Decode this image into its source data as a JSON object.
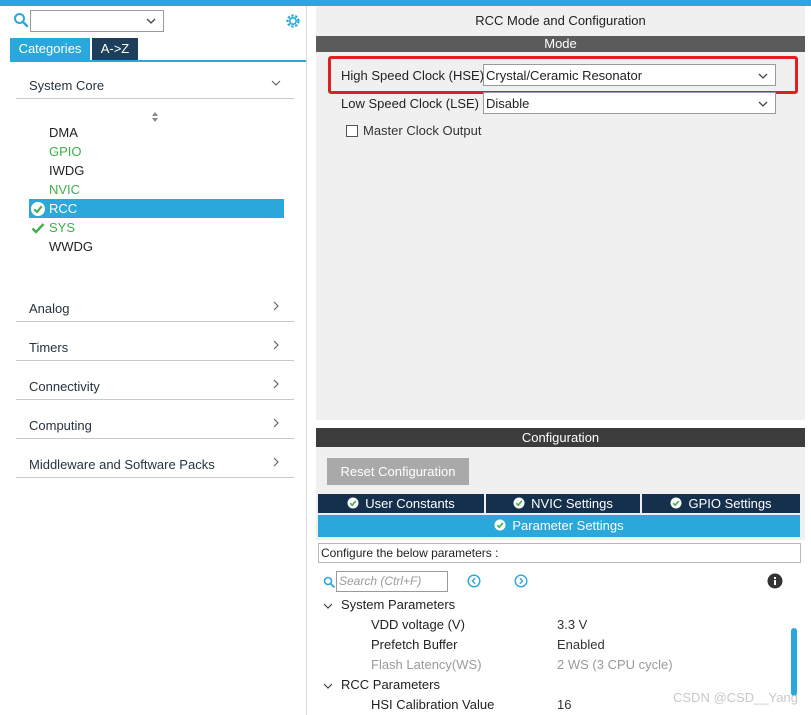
{
  "left": {
    "search": {
      "value": ""
    },
    "tabs": [
      {
        "label": "Categories",
        "active": true
      },
      {
        "label": "A->Z",
        "active": false
      }
    ],
    "system_core": {
      "label": "System Core",
      "items": [
        {
          "label": "DMA",
          "state": "normal"
        },
        {
          "label": "GPIO",
          "state": "configured"
        },
        {
          "label": "IWDG",
          "state": "normal"
        },
        {
          "label": "NVIC",
          "state": "configured"
        },
        {
          "label": "RCC",
          "state": "selected-checked"
        },
        {
          "label": "SYS",
          "state": "checked"
        },
        {
          "label": "WWDG",
          "state": "normal"
        }
      ]
    },
    "categories": [
      {
        "label": "Analog"
      },
      {
        "label": "Timers"
      },
      {
        "label": "Connectivity"
      },
      {
        "label": "Computing"
      },
      {
        "label": "Middleware and Software Packs"
      }
    ]
  },
  "right": {
    "title": "RCC Mode and Configuration",
    "mode_header": "Mode",
    "hse": {
      "label": "High Speed Clock (HSE)",
      "value": "Crystal/Ceramic Resonator"
    },
    "lse": {
      "label": "Low Speed Clock (LSE)",
      "value": "Disable"
    },
    "mco": {
      "label": "Master Clock Output",
      "checked": false
    },
    "config_header": "Configuration",
    "reset_button": "Reset Configuration",
    "settings_tabs": [
      {
        "label": "User Constants"
      },
      {
        "label": "NVIC Settings"
      },
      {
        "label": "GPIO Settings"
      }
    ],
    "parameter_tab": "Parameter Settings",
    "hint": "Configure the below parameters :",
    "search_placeholder": "Search (Ctrl+F)",
    "groups": [
      {
        "label": "System Parameters",
        "rows": [
          {
            "name": "VDD voltage (V)",
            "value": "3.3 V",
            "dim": false
          },
          {
            "name": "Prefetch Buffer",
            "value": "Enabled",
            "dim": false
          },
          {
            "name": "Flash Latency(WS)",
            "value": "2 WS (3 CPU cycle)",
            "dim": true
          }
        ]
      },
      {
        "label": "RCC Parameters",
        "rows": [
          {
            "name": "HSI Calibration Value",
            "value": "16",
            "dim": false
          }
        ]
      }
    ]
  },
  "watermark": "CSDN @CSD__Yang",
  "colors": {
    "accent": "#2aa8dc",
    "dark_tab": "#14304d",
    "configured": "#3cb04a",
    "highlight": "#e02020"
  }
}
